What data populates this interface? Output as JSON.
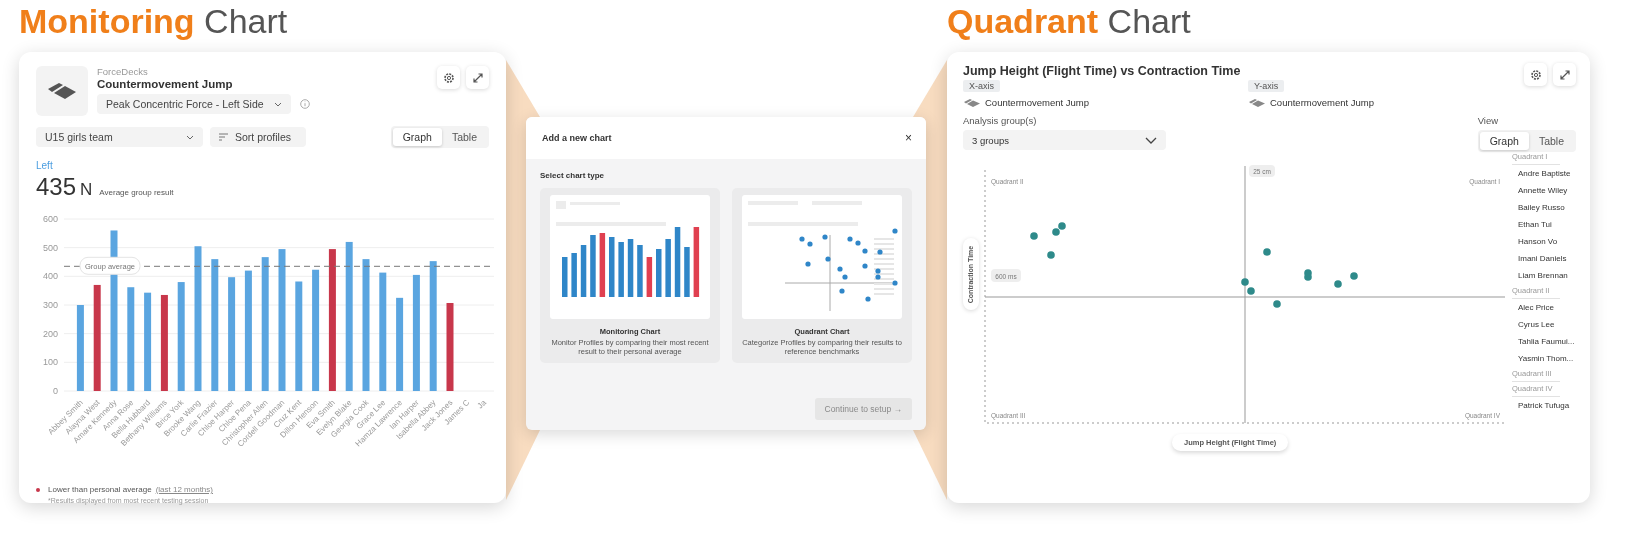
{
  "headings": [
    {
      "accent": "Monitoring",
      "rest": "Chart"
    },
    {
      "accent": "Quadrant",
      "rest": "Chart"
    }
  ],
  "monitoring_card": {
    "source": "ForceDecks",
    "test": "Countermovement Jump",
    "metric": "Peak Concentric Force - Left Side",
    "group": "U15 girls team",
    "sort": "Sort profiles",
    "view_tabs": [
      {
        "label": "Graph",
        "selected": true
      },
      {
        "label": "Table",
        "selected": false
      }
    ],
    "side": "Left",
    "value": "435",
    "unit": "N",
    "value_caption": "Average group result",
    "chart_data": {
      "type": "bar",
      "categories": [
        "Abbey Smith",
        "Alayna West",
        "Amare Kennedy",
        "Anna Rose",
        "Bella Hubbard",
        "Bethany Williams",
        "Brice York",
        "Brooke Wang",
        "Carlie Frazier",
        "Chloe Harper",
        "Chloe Pena",
        "Christopher Allen",
        "Cordell Goodman",
        "Cruz Kent",
        "Dillon Henson",
        "Eva Smith",
        "Evelyn Blake",
        "Georgia Cook",
        "Grace Lee",
        "Hamza Lawrence",
        "Ian Harper",
        "Isabella Abbey",
        "Jack Jones",
        "James C",
        "Ja"
      ],
      "series": [
        {
          "color": "#5aa5e0",
          "values": [
            300,
            null,
            560,
            362,
            343,
            null,
            380,
            505,
            460,
            397,
            420,
            467,
            495,
            382,
            423,
            null,
            520,
            460,
            413,
            325,
            405,
            453,
            null,
            null,
            null
          ]
        },
        {
          "name": "Lower than personal average",
          "color": "#c8374b",
          "values": [
            null,
            370,
            null,
            null,
            null,
            335,
            null,
            null,
            null,
            null,
            null,
            null,
            null,
            null,
            null,
            495,
            null,
            null,
            null,
            null,
            null,
            null,
            307,
            null,
            null
          ]
        }
      ],
      "stacked": true,
      "ylim": [
        0,
        600
      ],
      "yticks": [
        0,
        100,
        200,
        300,
        400,
        500,
        600
      ],
      "grid": true,
      "ref_lines": [
        {
          "axis": "y",
          "value": 435,
          "label": "Group average"
        }
      ]
    },
    "legend": {
      "link": "(last 12 months)"
    },
    "footnote": "*Results displayed from most recent testing session"
  },
  "modal": {
    "title": "Add a new chart",
    "close": "×",
    "section": "Select chart type",
    "options": [
      {
        "kind": "bars",
        "title": "Monitoring Chart",
        "description": "Monitor Profiles by comparing their most recent result to their personal average"
      },
      {
        "kind": "scatter",
        "title": "Quadrant Chart",
        "description": "Categorize Profiles by comparing their results to reference benchmarks"
      }
    ],
    "continue_button": {
      "label": "Continue to setup",
      "arrow": "→",
      "disabled": true
    }
  },
  "quadrant_card": {
    "title": "Jump Height (Flight Time) vs Contraction Time",
    "axes": [
      {
        "tag": "X-axis",
        "test": "Countermovement Jump"
      },
      {
        "tag": "Y-axis",
        "test": "Countermovement Jump"
      }
    ],
    "group_label": "Analysis group(s)",
    "group_value": "3 groups",
    "view_label": "View",
    "view_tabs": [
      {
        "label": "Graph",
        "selected": true
      },
      {
        "label": "Table",
        "selected": false
      }
    ],
    "plot": {
      "quadrant_labels": [
        "Quadrant II",
        "Quadrant I",
        "Quadrant III",
        "Quadrant IV"
      ],
      "x_reference": "25 cm",
      "y_reference": "600 ms",
      "x_title": "Jump Height (Flight Time)",
      "y_title": "Contraction Time"
    },
    "profile_groups": [
      {
        "name": "Quadrant I",
        "profiles": [
          "Andre Baptiste",
          "Annette Wiley",
          "Bailey Russo",
          "Ethan Tui",
          "Hanson Vo",
          "Imani Daniels",
          "Liam Brennan"
        ]
      },
      {
        "name": "Quadrant II",
        "profiles": [
          "Alec Price",
          "Cyrus Lee",
          "Tahlia Faumui...",
          "Yasmin Thom..."
        ]
      },
      {
        "name": "Quadrant III"
      },
      {
        "name": "Quadrant IV",
        "profiles": [
          "Patrick Tufuga"
        ]
      }
    ]
  }
}
